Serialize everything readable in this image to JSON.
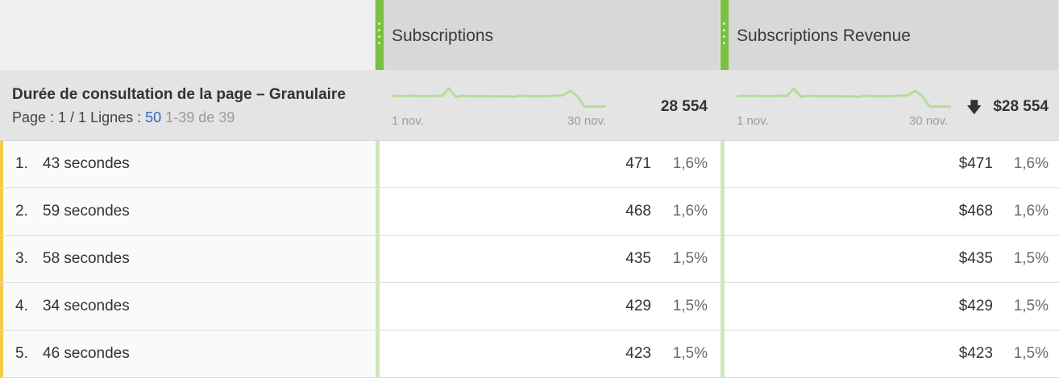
{
  "header": {
    "columns": [
      {
        "title": "Subscriptions"
      },
      {
        "title": "Subscriptions Revenue"
      }
    ]
  },
  "summary": {
    "dimension_name": "Durée de consultation de la page – Granulaire",
    "pager": {
      "page_label": "Page : 1 / 1",
      "rows_label": "Lignes :",
      "rows_value": "50",
      "range": "1-39 de 39"
    },
    "axis_start": "1 nov.",
    "axis_end": "30 nov.",
    "totals": [
      "28 554",
      "$28 554"
    ],
    "trend_icon": "arrow-down-icon"
  },
  "sparkline": {
    "color": "#b6dc9a",
    "values": [
      0.52,
      0.5,
      0.52,
      0.5,
      0.52,
      0.52,
      0.5,
      0.52,
      0.2,
      0.55,
      0.5,
      0.52,
      0.52,
      0.52,
      0.52,
      0.53,
      0.52,
      0.55,
      0.5,
      0.52,
      0.52,
      0.52,
      0.52,
      0.5,
      0.48,
      0.3,
      0.52,
      0.95,
      0.95,
      0.95,
      0.95
    ]
  },
  "colors": {
    "column_accent": "#7ac142",
    "row_marker": "#f6cc47",
    "link_blue": "#2d6ac6"
  },
  "rows": [
    {
      "index": "1.",
      "label": "43 secondes",
      "subs": "471",
      "subs_pct": "1,6%",
      "rev": "$471",
      "rev_pct": "1,6%"
    },
    {
      "index": "2.",
      "label": "59 secondes",
      "subs": "468",
      "subs_pct": "1,6%",
      "rev": "$468",
      "rev_pct": "1,6%"
    },
    {
      "index": "3.",
      "label": "58 secondes",
      "subs": "435",
      "subs_pct": "1,5%",
      "rev": "$435",
      "rev_pct": "1,5%"
    },
    {
      "index": "4.",
      "label": "34 secondes",
      "subs": "429",
      "subs_pct": "1,5%",
      "rev": "$429",
      "rev_pct": "1,5%"
    },
    {
      "index": "5.",
      "label": "46 secondes",
      "subs": "423",
      "subs_pct": "1,5%",
      "rev": "$423",
      "rev_pct": "1,5%"
    }
  ]
}
